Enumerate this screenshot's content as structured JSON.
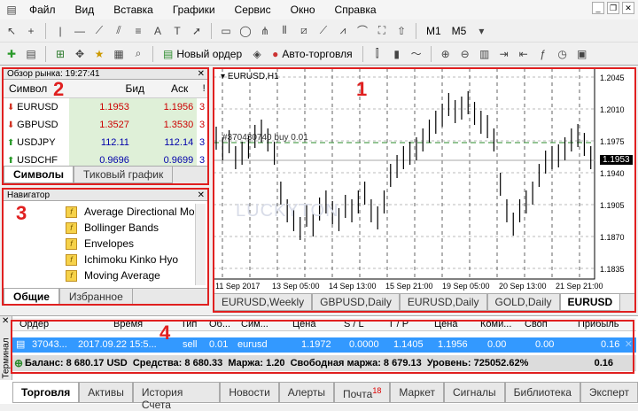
{
  "menu": [
    "Файл",
    "Вид",
    "Вставка",
    "Графики",
    "Сервис",
    "Окно",
    "Справка"
  ],
  "toolbar": {
    "new_order": "Новый ордер",
    "autotrading": "Авто-торговля",
    "m1": "M1",
    "m5": "M5"
  },
  "market_watch": {
    "title": "Обзор рынка: 19:27:41",
    "cols": [
      "Символ",
      "Бид",
      "Аск",
      "!"
    ],
    "rows": [
      {
        "sym": "EURUSD",
        "bid": "1.1953",
        "ask": "1.1956",
        "spread": "3",
        "dir": "down"
      },
      {
        "sym": "GBPUSD",
        "bid": "1.3527",
        "ask": "1.3530",
        "spread": "3",
        "dir": "down"
      },
      {
        "sym": "USDJPY",
        "bid": "112.11",
        "ask": "112.14",
        "spread": "3",
        "dir": "up"
      },
      {
        "sym": "USDCHF",
        "bid": "0.9696",
        "ask": "0.9699",
        "spread": "3",
        "dir": "up"
      }
    ],
    "tabs": [
      "Символы",
      "Тиковый график"
    ]
  },
  "navigator": {
    "title": "Навигатор",
    "items": [
      "Average Directional Mo",
      "Bollinger Bands",
      "Envelopes",
      "Ichimoku Kinko Hyo",
      "Moving Average"
    ],
    "tabs": [
      "Общие",
      "Избранное"
    ]
  },
  "chart": {
    "symbol": "EURUSD,H1",
    "order_label": "#370430740 buy 0.01",
    "price_tag": "1.1953",
    "watermark": "LUCKYTON",
    "y_ticks": [
      "1.2045",
      "1.2010",
      "1.1975",
      "1.1940",
      "1.1905",
      "1.1870",
      "1.1835"
    ],
    "x_ticks": [
      "11 Sep 2017",
      "13 Sep 05:00",
      "14 Sep 13:00",
      "15 Sep 21:00",
      "19 Sep 05:00",
      "20 Sep 13:00",
      "21 Sep 21:00"
    ],
    "tabs": [
      "EURUSD,Weekly",
      "GBPUSD,Daily",
      "EURUSD,Daily",
      "GOLD,Daily",
      "EURUSD"
    ]
  },
  "terminal": {
    "side_label": "Терминал",
    "cols": [
      "Ордер",
      "Время",
      "Тип",
      "Об...",
      "Сим...",
      "Цена",
      "S / L",
      "T / P",
      "Цена",
      "Коми...",
      "Своп",
      "Прибыль"
    ],
    "row": [
      "37043...",
      "2017.09.22 15:5...",
      "sell",
      "0.01",
      "eurusd",
      "1.1972",
      "0.0000",
      "1.1405",
      "1.1956",
      "0.00",
      "0.00",
      "0.16"
    ],
    "balance": "Баланс: 8 680.17 USD  Средства: 8 680.33  Маржа: 1.20  Свободная маржа: 8 679.13  Уровень: 725052.62%",
    "balance_profit": "0.16",
    "tabs": [
      "Торговля",
      "Активы",
      "История Счета",
      "Новости",
      "Алерты",
      "Почта",
      "Маркет",
      "Сигналы",
      "Библиотека",
      "Эксперт"
    ],
    "mail_count": "18"
  },
  "annotations": [
    "1",
    "2",
    "3",
    "4"
  ],
  "colors": {
    "annotation": "#e02020",
    "selected_row": "#3399ff",
    "chart_up": "#000000"
  }
}
